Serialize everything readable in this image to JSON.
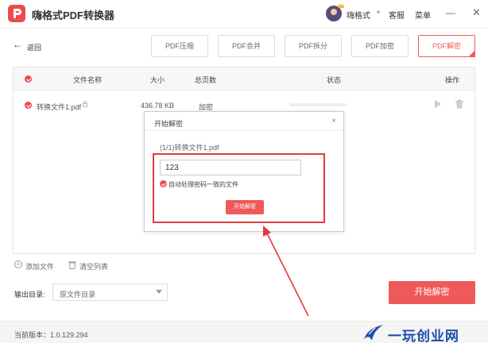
{
  "app": {
    "title": "嗨格式PDF转换器",
    "logo_letter": "P"
  },
  "header": {
    "username": "嗨格式",
    "service": "客服",
    "menu": "菜单",
    "minimize": "—",
    "close": "✕"
  },
  "toolbar": {
    "back": "返回",
    "tabs": [
      {
        "label": "PDF压缩"
      },
      {
        "label": "PDF合并"
      },
      {
        "label": "PDF拆分"
      },
      {
        "label": "PDF加密"
      },
      {
        "label": "PDF解密",
        "active": true
      }
    ]
  },
  "table": {
    "headers": {
      "name": "文件名称",
      "size": "大小",
      "pages": "总页数",
      "status": "状态",
      "action": "操作"
    },
    "rows": [
      {
        "name": "转换文件1.pdf",
        "size": "436.78 KB",
        "pages": "加密"
      }
    ]
  },
  "bottom": {
    "add_file": "添加文件",
    "clear_list": "清空列表",
    "output_label": "输出目录:",
    "output_value": "原文件目录",
    "start": "开始解密"
  },
  "status": {
    "version": "当前版本：1.0.129.294"
  },
  "watermark": {
    "text": "一玩创业网"
  },
  "modal": {
    "title": "开始解密",
    "close": "×",
    "file": "(1/1)转换文件1.pdf",
    "password": "123",
    "auto_label": "自动处理密码一致的文件",
    "start": "开始解密"
  },
  "colors": {
    "accent": "#ee5a5a",
    "highlight": "#e23b3b",
    "watermark": "#1d4fa8"
  }
}
